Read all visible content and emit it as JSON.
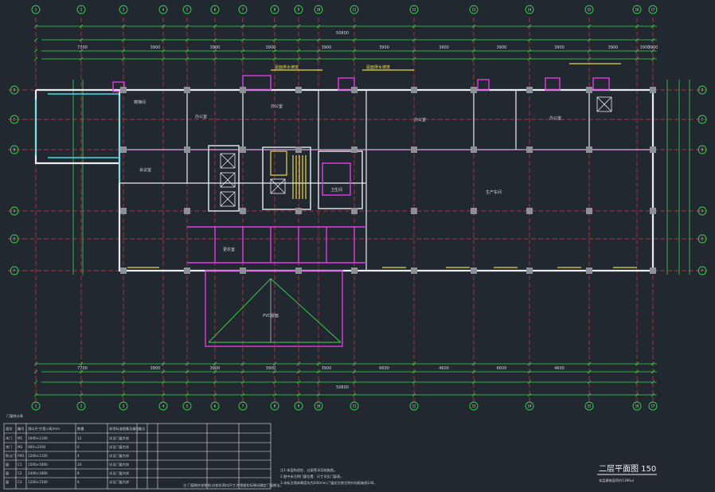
{
  "drawing": {
    "title": "二层平面图 150",
    "subtitle": "本层建筑面积约1390㎡",
    "background": "#212830"
  },
  "column_axes": {
    "labels": [
      "1",
      "2",
      "3",
      "4",
      "5",
      "6",
      "7",
      "8",
      "9",
      "10",
      "11",
      "12",
      "13",
      "14",
      "15",
      "16",
      "17"
    ]
  },
  "row_axes": {
    "labels": [
      "D",
      "C",
      "B",
      "A",
      "E",
      "F"
    ]
  },
  "dimensions": {
    "top_total": "50800",
    "bottom_total": "50800",
    "top_segments": [
      "7700",
      "3900",
      "3900",
      "3900",
      "3900",
      "3900",
      "3900",
      "3900",
      "3900",
      "3900",
      "3900",
      "3900"
    ],
    "bottom_segments": [
      "7700",
      "3900",
      "3900",
      "3900",
      "3900",
      "6600",
      "4600",
      "6600",
      "4600"
    ]
  },
  "room_labels": [
    {
      "text": "办公室",
      "tone": "light"
    },
    {
      "text": "办公室",
      "tone": "light"
    },
    {
      "text": "办公室",
      "tone": "light"
    },
    {
      "text": "办公室",
      "tone": "light"
    },
    {
      "text": "会议室",
      "tone": "light"
    },
    {
      "text": "生产车间",
      "tone": "light"
    },
    {
      "text": "楼梯间",
      "tone": "light"
    },
    {
      "text": "卫生间",
      "tone": "light"
    },
    {
      "text": "更衣室",
      "tone": "light"
    },
    {
      "text": "PVC屋面",
      "tone": "light"
    },
    {
      "text": "屋面排水坡度",
      "tone": "yellow"
    },
    {
      "text": "屋面排水坡度",
      "tone": "yellow"
    }
  ],
  "door_window_table": {
    "heading": "门窗统计表",
    "header_cols": [
      "类别",
      "编号",
      "洞口尺寸(宽×高)mm",
      "数量",
      "采用标准图集及编号",
      "备注"
    ],
    "rows": [
      [
        "木门",
        "M1",
        "1000×2100",
        "12",
        "详见门窗大样",
        ""
      ],
      [
        "木门",
        "M2",
        "900×2100",
        "6",
        "详见门窗大样",
        ""
      ],
      [
        "防火门",
        "FM1",
        "1200×2100",
        "4",
        "详见门窗大样",
        ""
      ],
      [
        "窗",
        "C1",
        "1500×1800",
        "24",
        "详见门窗大样",
        ""
      ],
      [
        "窗",
        "C2",
        "2400×1800",
        "8",
        "详见门窗大样",
        ""
      ],
      [
        "窗",
        "C3",
        "1200×1500",
        "6",
        "详见门窗大样",
        ""
      ]
    ]
  },
  "notes": [
    "注1:本层构造柱、过梁等详见结施图。",
    "2.图中未注明门窗位置、尺寸详见门窗表。",
    "3.未标注墙体厚度均为200mm,门窗定位除注明外均距轴线100。"
  ],
  "table_note": "注:门窗制作安装前,应核实洞口尺寸,并根据实际情况确定门窗做法。",
  "colors": {
    "wall": "#e8ecef",
    "axis_line": "#d63a3a",
    "dimension": "#39d64a",
    "magenta": "#e23ae6",
    "yellow": "#e8d84a",
    "cyan": "#3fe0e6",
    "column": "#8c9196"
  }
}
